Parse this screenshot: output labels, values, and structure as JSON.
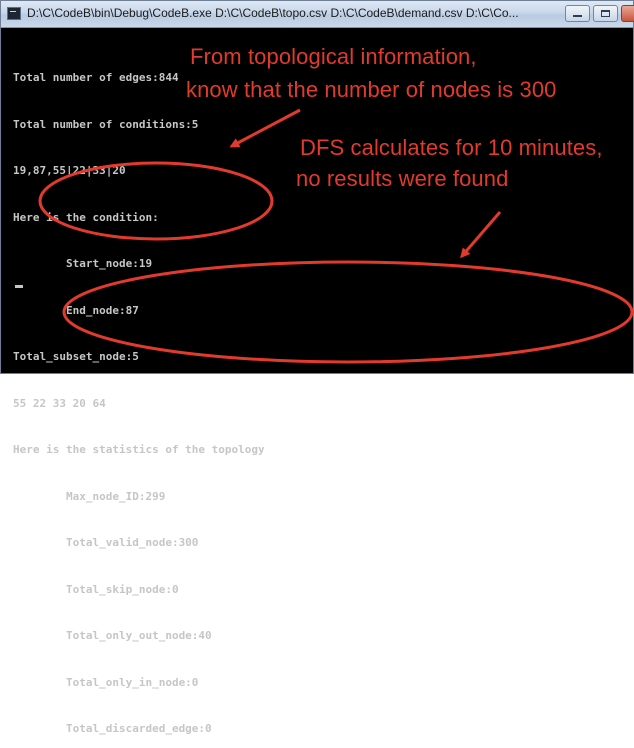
{
  "window": {
    "title": "D:\\C\\CodeB\\bin\\Debug\\CodeB.exe D:\\C\\CodeB\\topo.csv D:\\C\\CodeB\\demand.csv D:\\C\\Co..."
  },
  "console": {
    "lines": [
      "Total number of edges:844",
      "Total number of conditions:5",
      "19,87,55|22|33|20",
      "Here is the condition:",
      "        Start_node:19",
      "        End_node:87",
      "Total_subset_node:5",
      "55 22 33 20 64",
      "Here is the statistics of the topology",
      "        Max_node_ID:299",
      "        Total_valid_node:300",
      "        Total_skip_node:0",
      "        Total_only_out_node:40",
      "        Total_only_in_node:0",
      "        Total_discarded_edge:0"
    ]
  },
  "annotations": {
    "topology_line1": "From topological information,",
    "topology_line2": "know that the number of nodes is 300",
    "dfs_line1": "DFS calculates for 10 minutes,",
    "dfs_line2": "no results were found",
    "color": "#e23a2c"
  }
}
